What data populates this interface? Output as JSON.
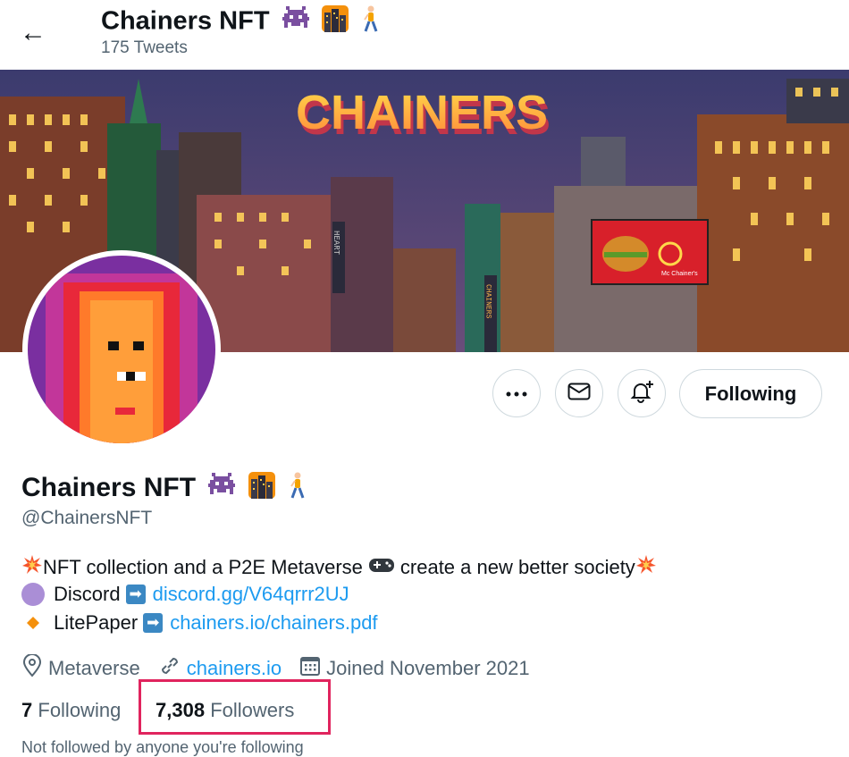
{
  "header": {
    "name": "Chainers NFT",
    "tweet_count": "175 Tweets"
  },
  "banner": {
    "title": "CHAINERS",
    "sign_text": "HEART",
    "sign_text2": "CHAINERS",
    "billboard_text": "Mc Chainer's"
  },
  "profile": {
    "name": "Chainers NFT",
    "handle": "@ChainersNFT",
    "follow_label": "Following"
  },
  "bio": {
    "line1": "NFT collection and a P2E Metaverse",
    "line1b": "create a new better society",
    "discord_label": "Discord",
    "discord_link": "discord.gg/V64qrrr2UJ",
    "litepaper_label": "LitePaper",
    "litepaper_link": "chainers.io/chainers.pdf"
  },
  "meta": {
    "location": "Metaverse",
    "website": "chainers.io",
    "joined": "Joined November 2021"
  },
  "stats": {
    "following_count": "7",
    "following_label": "Following",
    "followers_count": "7,308",
    "followers_label": "Followers"
  },
  "footer": {
    "partial_text": "Not followed by anyone you're following"
  },
  "colors": {
    "link": "#1d9bf0",
    "muted": "#536471",
    "highlight": "#e0245e"
  }
}
